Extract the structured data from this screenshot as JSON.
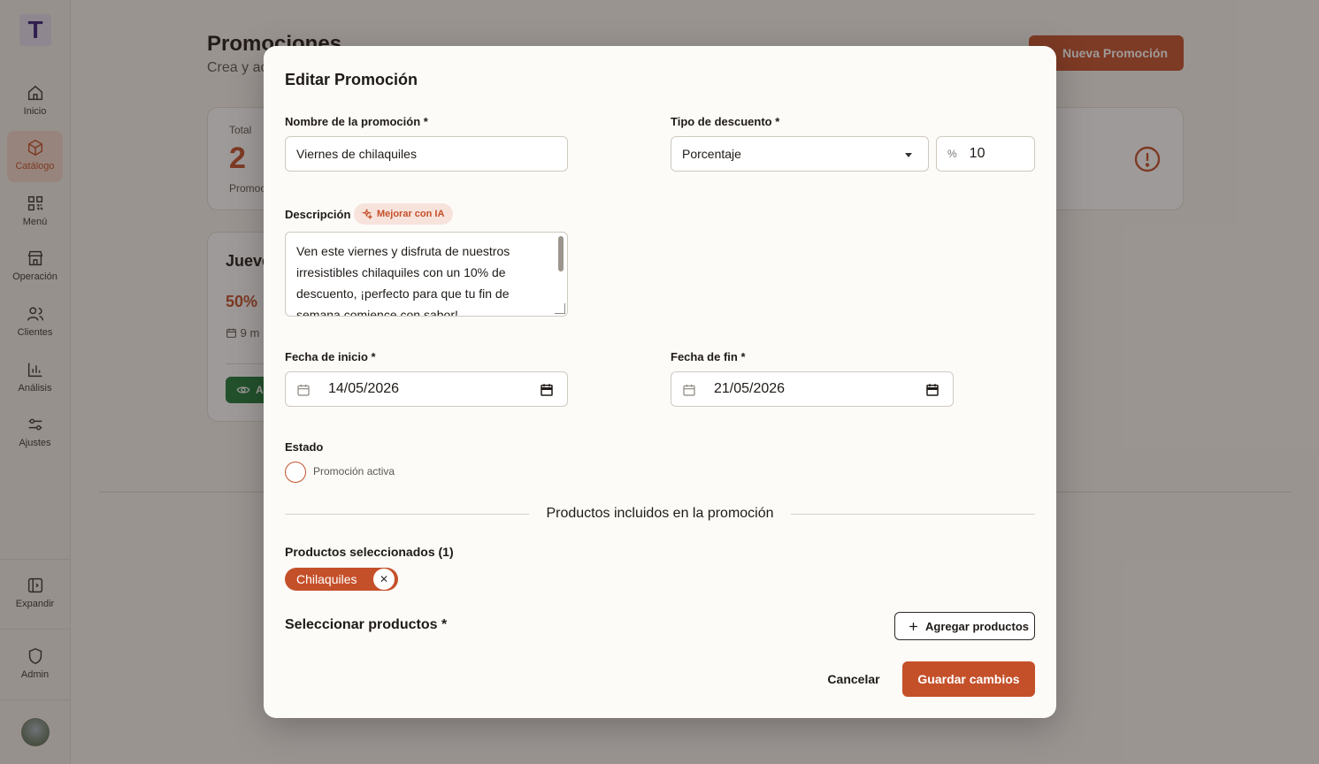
{
  "app": {
    "logo_letter": "T"
  },
  "sidebar": {
    "items": [
      {
        "label": "Inicio",
        "icon": "home-icon"
      },
      {
        "label": "Catálogo",
        "icon": "box-icon",
        "active": true
      },
      {
        "label": "Menú",
        "icon": "qr-icon"
      },
      {
        "label": "Operación",
        "icon": "store-icon"
      },
      {
        "label": "Clientes",
        "icon": "users-icon"
      },
      {
        "label": "Análisis",
        "icon": "chart-icon"
      },
      {
        "label": "Ajustes",
        "icon": "sliders-icon"
      }
    ],
    "expand_label": "Expandir",
    "admin_label": "Admin"
  },
  "page": {
    "title": "Promociones",
    "subtitle": "Crea y ac",
    "new_button": "Nueva Promoción",
    "stats": {
      "label": "Total",
      "value": "2",
      "footer": "Promoc"
    },
    "promo_card": {
      "title": "Jueve",
      "discount": "50%",
      "date": "9 m",
      "button": "A"
    }
  },
  "modal": {
    "title": "Editar Promoción",
    "name_label": "Nombre de la promoción *",
    "name_value": "Viernes de chilaquiles",
    "discount_type_label": "Tipo de descuento *",
    "discount_type_value": "Porcentaje",
    "discount_symbol": "%",
    "discount_value": "10",
    "description_label": "Descripción",
    "ai_button": "Mejorar con IA",
    "description_value": "Ven este viernes y disfruta de nuestros irresistibles chilaquiles con un 10% de descuento, ¡perfecto para que tu fin de semana comience con sabor!",
    "start_label": "Fecha de inicio *",
    "start_value": "14/05/2026",
    "end_label": "Fecha de fin *",
    "end_value": "21/05/2026",
    "status_label": "Estado",
    "active_label": "Promoción activa",
    "products_divider": "Productos incluidos en la promoción",
    "selected_title": "Productos seleccionados (1)",
    "selected_products": [
      "Chilaquiles"
    ],
    "select_title": "Seleccionar productos *",
    "add_products": "Agregar productos",
    "cancel": "Cancelar",
    "save": "Guardar cambios"
  },
  "colors": {
    "accent": "#c4502a",
    "success": "#1f7a3a"
  }
}
